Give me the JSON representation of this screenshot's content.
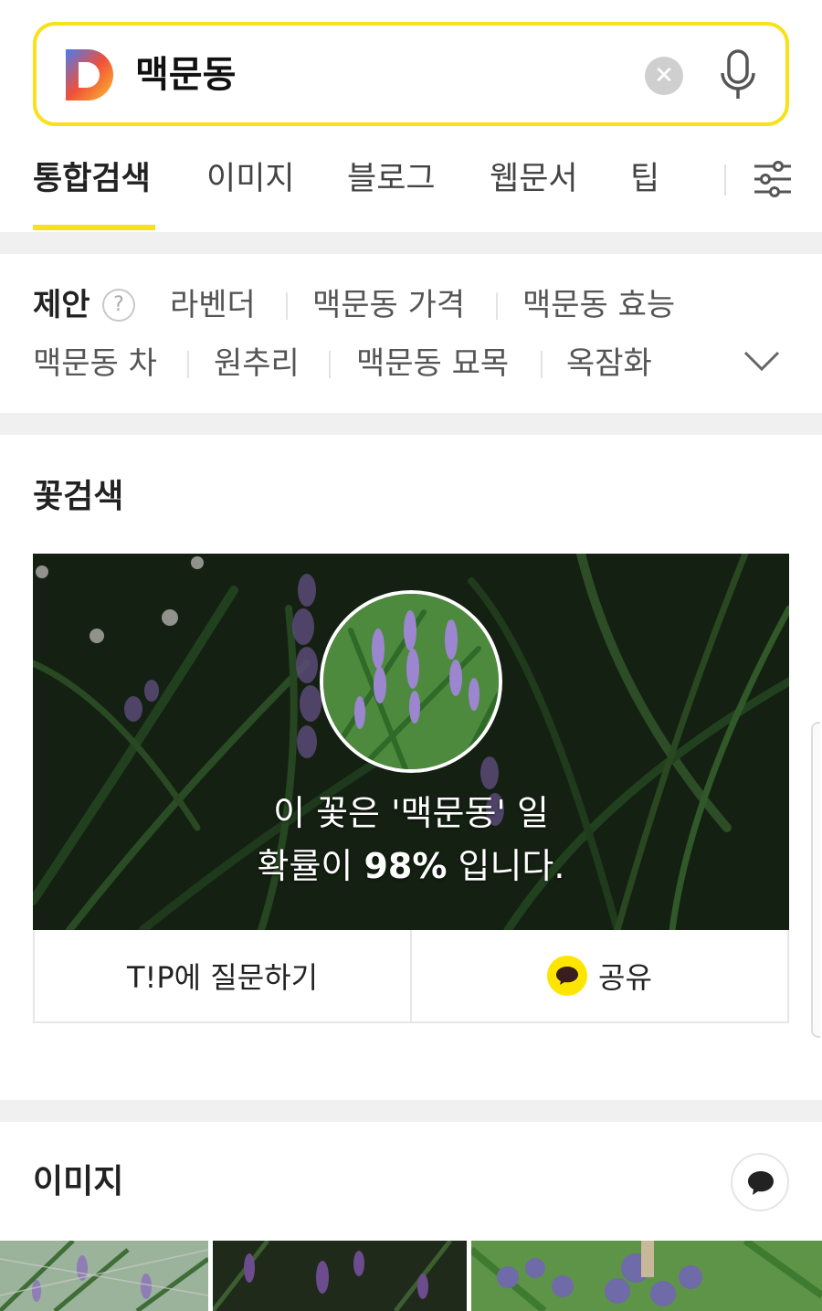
{
  "search": {
    "query": "맥문동",
    "clear_icon": "close-circle-icon",
    "mic_icon": "microphone-icon"
  },
  "tabs": [
    {
      "label": "통합검색",
      "active": true
    },
    {
      "label": "이미지",
      "active": false
    },
    {
      "label": "블로그",
      "active": false
    },
    {
      "label": "웹문서",
      "active": false
    },
    {
      "label": "팁",
      "active": false
    }
  ],
  "suggestions": {
    "label": "제안",
    "help": "?",
    "items": [
      "라벤더",
      "맥문동 가격",
      "맥문동 효능",
      "맥문동 차",
      "원추리",
      "맥문동 묘목",
      "옥잠화"
    ]
  },
  "flower_search": {
    "title": "꽃검색",
    "result_line1": "이 꽃은 '맥문동' 일",
    "result_line2_prefix": "확률이 ",
    "result_percent": "98%",
    "result_line2_suffix": " 입니다.",
    "ask_button": "T!P에 질문하기",
    "share_button": "공유"
  },
  "images": {
    "title": "이미지"
  },
  "colors": {
    "accent_yellow": "#f7e11a",
    "kakao_yellow": "#fee500",
    "lavender": "#8e6bbf",
    "foliage_dark": "#1f3a1e"
  }
}
